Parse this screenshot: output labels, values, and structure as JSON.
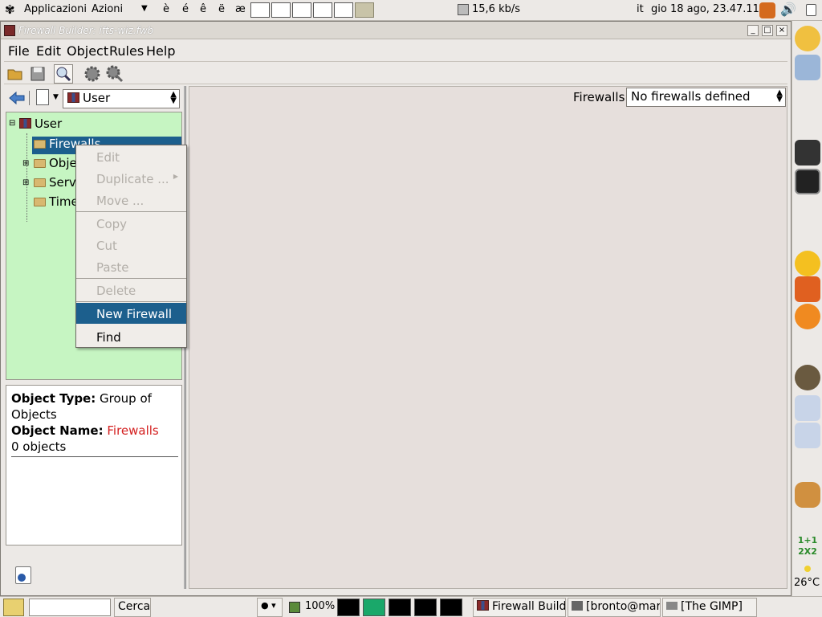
{
  "top_panel": {
    "menu_apps": "Applicazioni",
    "menu_actions": "Azioni",
    "chars": [
      "è",
      "é",
      "ê",
      "ë",
      "æ"
    ],
    "net_speed": "15,6 kb/s",
    "keyboard": "it",
    "datetime": "gio 18 ago, 23.47.11"
  },
  "window": {
    "title": "Firewall Builder: ifts-wiz.fwb",
    "menu": [
      "File",
      "Edit",
      "Object",
      "Rules",
      "Help"
    ]
  },
  "library_select": {
    "value": "User"
  },
  "tree": {
    "root": "User",
    "items": [
      "Firewalls",
      "Objects",
      "Services",
      "Time"
    ]
  },
  "info": {
    "type_label": "Object Type:",
    "type_value": "Group of Objects",
    "name_label": "Object Name:",
    "name_value": "Firewalls",
    "count": "0 objects"
  },
  "firewalls": {
    "label": "Firewalls:",
    "value": "No firewalls defined"
  },
  "context_menu": {
    "items": [
      {
        "label": "Edit"
      },
      {
        "label": "Duplicate ..."
      },
      {
        "label": "Move ..."
      },
      {
        "label": "Copy"
      },
      {
        "label": "Cut"
      },
      {
        "label": "Paste"
      },
      {
        "label": "Delete"
      },
      {
        "label": "New Firewall"
      },
      {
        "label": "Find"
      }
    ]
  },
  "bottom_panel": {
    "search_button": "Cerca",
    "battery": "100%",
    "tasks": [
      "Firewall Builder",
      "[bronto@marr",
      "[The GIMP]"
    ]
  },
  "dock": {
    "math_text": "1+1 2X2",
    "temperature": "26°C"
  },
  "colors": {
    "tree_bg": "#c6f5c2",
    "selection": "#1c5f8d",
    "object_name": "#d42020"
  }
}
